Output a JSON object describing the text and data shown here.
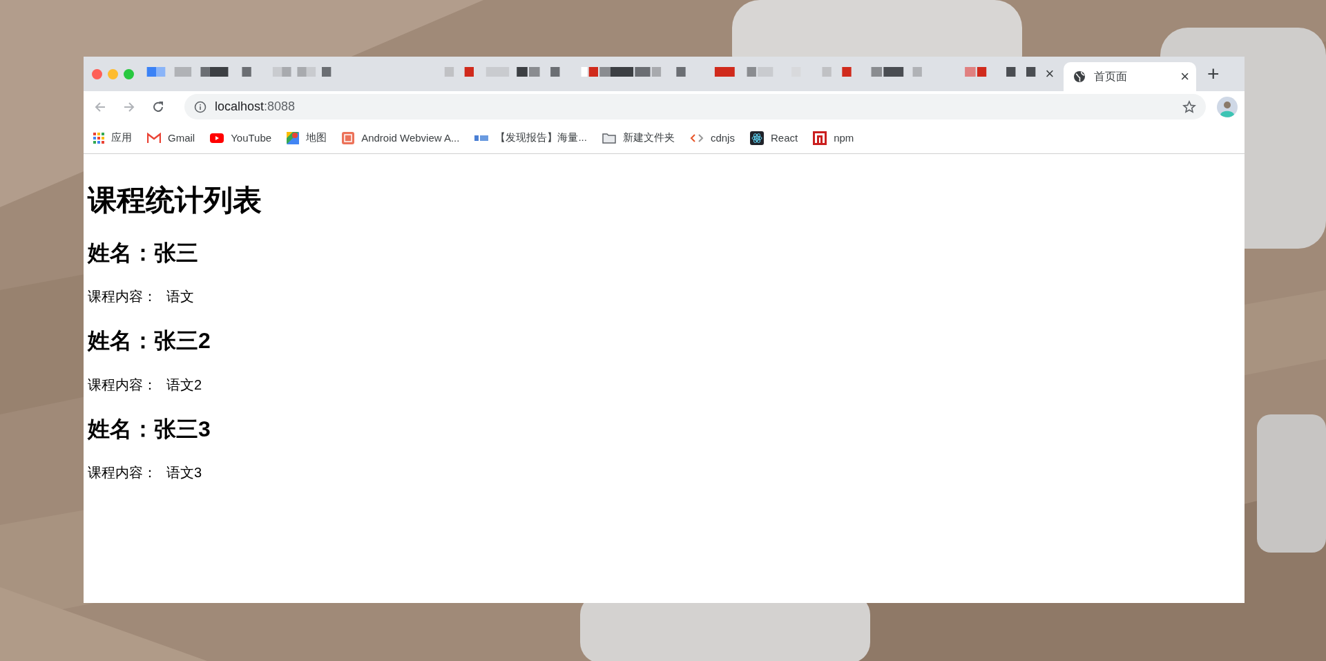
{
  "browser": {
    "hidden_tab_close": "×",
    "active_tab": {
      "title": "首页面",
      "close": "×",
      "selected": true
    },
    "new_tab": "+"
  },
  "address_bar": {
    "host": "localhost",
    "port": ":8088"
  },
  "bookmarks": [
    {
      "label": "应用"
    },
    {
      "label": "Gmail"
    },
    {
      "label": "YouTube"
    },
    {
      "label": "地图"
    },
    {
      "label": "Android Webview A..."
    },
    {
      "label": "【发现报告】海量..."
    },
    {
      "label": "新建文件夹"
    },
    {
      "label": "cdnjs"
    },
    {
      "label": "React"
    },
    {
      "label": "npm"
    }
  ],
  "page": {
    "title": "课程统计列表",
    "students": [
      {
        "name": "姓名：张三",
        "course_label": "课程内容：",
        "course": "语文"
      },
      {
        "name": "姓名：张三2",
        "course_label": "课程内容：",
        "course": "语文2"
      },
      {
        "name": "姓名：张三3",
        "course_label": "课程内容：",
        "course": "语文3"
      }
    ]
  }
}
